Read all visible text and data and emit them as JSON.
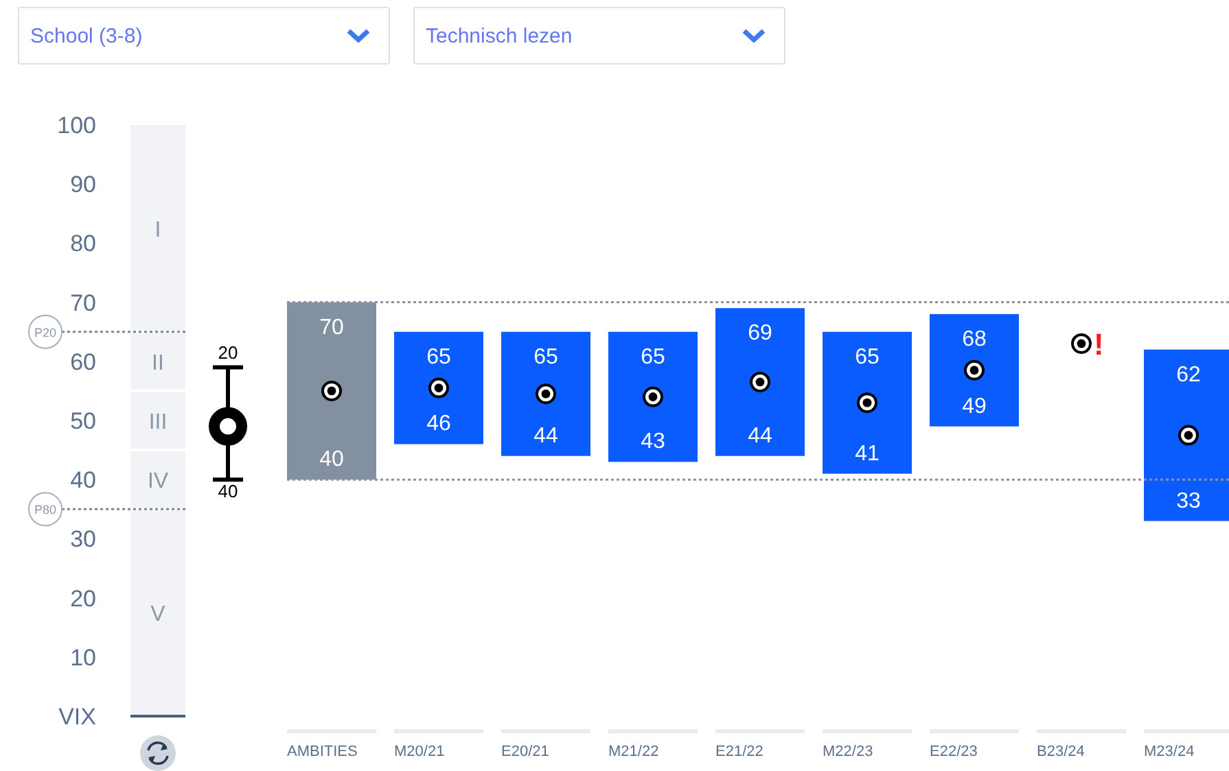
{
  "filters": [
    {
      "value": "School (3-8)"
    },
    {
      "value": "Technisch lezen"
    }
  ],
  "axis": {
    "ticks": [
      "100",
      "90",
      "80",
      "70",
      "60",
      "50",
      "40",
      "30",
      "20",
      "10",
      "VIX"
    ]
  },
  "levels": [
    {
      "label": "I"
    },
    {
      "label": "II"
    },
    {
      "label": "III"
    },
    {
      "label": "IV"
    },
    {
      "label": "V"
    }
  ],
  "percentiles": [
    {
      "label": "P20"
    },
    {
      "label": "P80"
    }
  ],
  "error_bar": {
    "top_label": "20",
    "bottom_label": "40"
  },
  "columns": [
    {
      "kind": "ambition",
      "label": "AMBITIES",
      "high": "70",
      "low": "40"
    },
    {
      "kind": "result",
      "label": "M20/21",
      "high": "65",
      "low": "46"
    },
    {
      "kind": "result",
      "label": "E20/21",
      "high": "65",
      "low": "44"
    },
    {
      "kind": "result",
      "label": "M21/22",
      "high": "65",
      "low": "43"
    },
    {
      "kind": "result",
      "label": "E21/22",
      "high": "69",
      "low": "44"
    },
    {
      "kind": "result",
      "label": "M22/23",
      "high": "65",
      "low": "41"
    },
    {
      "kind": "result",
      "label": "E22/23",
      "high": "68",
      "low": "49"
    },
    {
      "kind": "score-only",
      "label": "B23/24",
      "warning": "!"
    },
    {
      "kind": "result",
      "label": "M23/24",
      "high": "62",
      "low": "33"
    }
  ]
}
